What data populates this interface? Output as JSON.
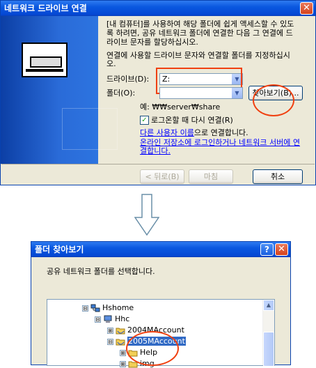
{
  "map_dialog": {
    "title": "네트워크 드라이브 연결",
    "close_glyph": "✕",
    "intro_line1": "[내 컴퓨터]를 사용하여 해당 폴더에 쉽게 액세스할 수 있도",
    "intro_line2": "록 하려면, 공유 네트워크 폴더에 연결한 다음 그 연결에 드",
    "intro_line3": "라이브 문자를 할당하십시오.",
    "instr_line1": "연결에 사용할 드라이브 문자와 연결할 폴더를 지정하십시",
    "instr_line2": "오.",
    "drive_label": "드라이브(D):",
    "drive_value": "Z:",
    "folder_label": "폴더(O):",
    "folder_value": "",
    "browse_button": "찾아보기(B)...",
    "example_text": "예: ₩₩server₩share",
    "reconnect_label": "로그온할 때 다시 연결(R)",
    "reconnect_checked": true,
    "other_user_link": "다른 사용자 이름",
    "other_user_suffix": "으로 연결합니다.",
    "online_storage_line1": "온라인 저장소에 로그인하거나 네트워크 서버에 연",
    "online_storage_line2": "결합니다.",
    "back_button": "< 뒤로(B)",
    "finish_button": "마침",
    "cancel_button": "취소"
  },
  "arrow_icon": "down-arrow-icon",
  "browse_dialog": {
    "title": "폴더 찾아보기",
    "help_glyph": "?",
    "close_glyph": "✕",
    "prompt": "공유 네트워크 폴더를 선택합니다.",
    "tree": [
      {
        "label": "Hshome",
        "toggle": "⊟",
        "icon": "network-icon",
        "level": 0,
        "selected": false
      },
      {
        "label": "Hhc",
        "toggle": "⊟",
        "icon": "computer-icon",
        "level": 1,
        "selected": false
      },
      {
        "label": "2004MAccount",
        "toggle": "⊞",
        "icon": "shared-folder-icon",
        "level": 2,
        "selected": false
      },
      {
        "label": "2005MAccount",
        "toggle": "⊟",
        "icon": "shared-folder-icon",
        "level": 2,
        "selected": true
      },
      {
        "label": "Help",
        "toggle": "⊞",
        "icon": "folder-icon",
        "level": 3,
        "selected": false
      },
      {
        "label": "img",
        "toggle": "⊞",
        "icon": "folder-icon",
        "level": 3,
        "selected": false
      }
    ]
  },
  "colors": {
    "annotation_red": "#f04010",
    "title_blue": "#0548d4",
    "selection_blue": "#316ac5"
  }
}
